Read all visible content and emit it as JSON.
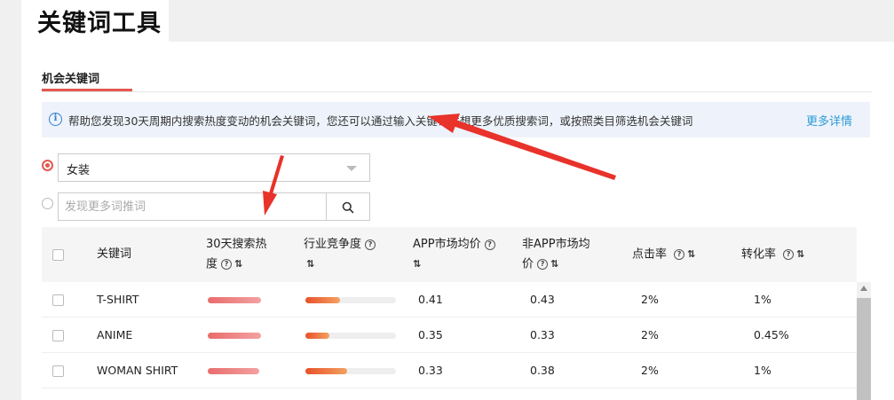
{
  "header": {
    "title": "关键词工具"
  },
  "tabs": [
    {
      "label": "机会关键词",
      "active": true
    }
  ],
  "info": {
    "icon": "info-icon",
    "text": "帮助您发现30天周期内搜索热度变动的机会关键词，您还可以通过输入关键词联想更多优质搜索词，或按照类目筛选机会关键词",
    "link": "更多详情"
  },
  "filters": {
    "category": {
      "selected": "女装",
      "checked": true
    },
    "search": {
      "placeholder": "发现更多词推词",
      "value": "",
      "checked": false
    }
  },
  "table": {
    "columns": {
      "keyword": "关键词",
      "heat_line1": "30天搜索热",
      "heat_line2": "度",
      "competition": "行业竞争度",
      "app_price": "APP市场均价",
      "nonapp_line1": "非APP市场均",
      "nonapp_line2": "价",
      "ctr": "点击率",
      "cvr": "转化率"
    },
    "rows": [
      {
        "keyword": "T-SHIRT",
        "heat": 0.59,
        "competition": 0.38,
        "app_price": "0.41",
        "nonapp_price": "0.43",
        "ctr": "2%",
        "cvr": "1%"
      },
      {
        "keyword": "ANIME",
        "heat": 0.59,
        "competition": 0.26,
        "app_price": "0.35",
        "nonapp_price": "0.33",
        "ctr": "2%",
        "cvr": "0.45%"
      },
      {
        "keyword": "WOMAN SHIRT",
        "heat": 0.57,
        "competition": 0.46,
        "app_price": "0.33",
        "nonapp_price": "0.38",
        "ctr": "2%",
        "cvr": "1%"
      }
    ]
  },
  "colors": {
    "accent": "#e4574f",
    "link": "#2e9bd6",
    "annotation_arrow": "#e8322a"
  }
}
